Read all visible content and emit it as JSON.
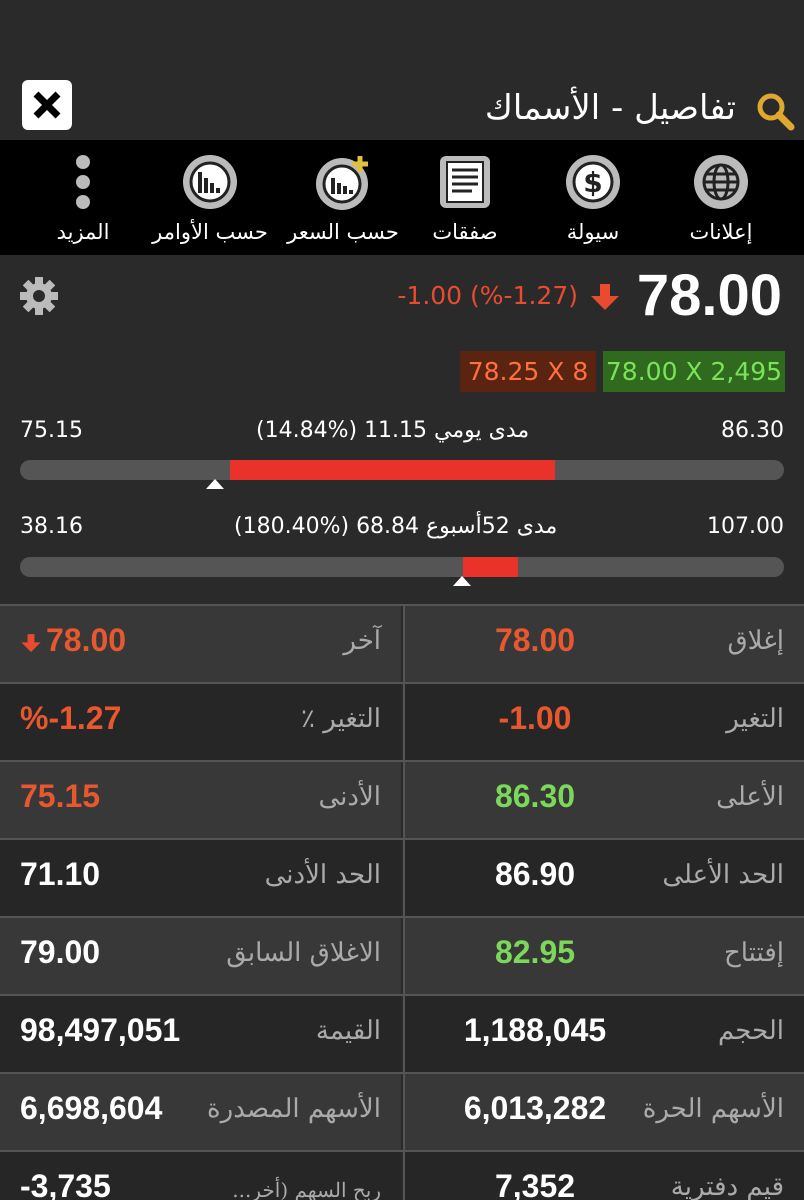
{
  "header": {
    "title": "تفاصيل - الأسماك"
  },
  "toolbar": {
    "items": [
      {
        "label": "إعلانات",
        "icon": "globe-icon"
      },
      {
        "label": "سيولة",
        "icon": "dollar-icon"
      },
      {
        "label": "صفقات",
        "icon": "document-icon"
      },
      {
        "label": "حسب السعر",
        "icon": "chart-add-icon"
      },
      {
        "label": "حسب الأوامر",
        "icon": "bar-chart-icon"
      },
      {
        "label": "المزيد",
        "icon": "more-icon"
      }
    ]
  },
  "quote": {
    "price": "78.00",
    "change": "-1.00 (%-1.27)",
    "ask": "78.25 X 8",
    "bid": "78.00 X 2,495"
  },
  "daily_range": {
    "low": "75.15",
    "high": "86.30",
    "label": "مدى يومي 11.15 (%14.84)",
    "fill_from": 0.275,
    "fill_to": 0.7,
    "marker": 0.255
  },
  "week52_range": {
    "low": "38.16",
    "high": "107.00",
    "label": "مدى 52أسبوع 68.84 (%180.40)",
    "fill_from": 0.58,
    "fill_to": 0.652,
    "marker": 0.578
  },
  "stats": [
    {
      "right_label": "إغلاق",
      "right_value": "78.00",
      "right_color": "red",
      "left_label": "آخر",
      "left_value": "78.00",
      "left_color": "red",
      "left_arrow": true
    },
    {
      "right_label": "التغير",
      "right_value": "-1.00",
      "right_color": "red",
      "left_label": "التغير ٪",
      "left_value": "%-1.27",
      "left_color": "red"
    },
    {
      "right_label": "الأعلى",
      "right_value": "86.30",
      "right_color": "green",
      "left_label": "الأدنى",
      "left_value": "75.15",
      "left_color": "red"
    },
    {
      "right_label": "الحد الأعلى",
      "right_value": "86.90",
      "right_color": "white",
      "left_label": "الحد الأدنى",
      "left_value": "71.10",
      "left_color": "white"
    },
    {
      "right_label": "إفتتاح",
      "right_value": "82.95",
      "right_color": "green",
      "left_label": "الاغلاق السابق",
      "left_value": "79.00",
      "left_color": "white"
    },
    {
      "right_label": "الحجم",
      "right_value": "1,188,045",
      "right_color": "white",
      "left_label": "القيمة",
      "left_value": "98,497,051",
      "left_color": "white"
    },
    {
      "right_label": "الأسهم الحرة",
      "right_value": "6,013,282",
      "right_color": "white",
      "left_label": "الأسهم المصدرة",
      "left_value": "6,698,604",
      "left_color": "white"
    },
    {
      "right_label": "قيم دفترية",
      "right_value": "7,352",
      "right_color": "white",
      "left_label": "ربح السهم (أخر...",
      "left_value": "-3,735",
      "left_color": "white",
      "left_small": true
    }
  ],
  "colors": {
    "accent_red": "#e8582f",
    "accent_green": "#7bd85a",
    "toolbar_bg": "#000000",
    "bar_fill": "#e8322a"
  }
}
